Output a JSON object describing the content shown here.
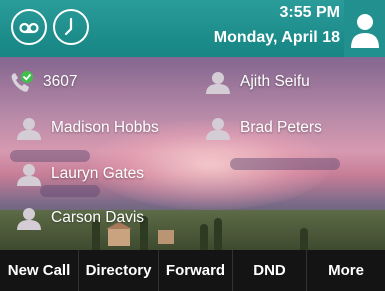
{
  "status_bar": {
    "time": "3:55 PM",
    "date": "Monday, April 18"
  },
  "icons": {
    "voicemail": "voicemail-icon",
    "clock": "clock-icon",
    "user": "user-avatar-icon",
    "phone": "phone-registered-icon",
    "contact": "person-icon"
  },
  "contacts": [
    {
      "name": "3607",
      "icon": "phone-registered-icon"
    },
    {
      "name": "Ajith Seifu",
      "icon": "person-icon"
    },
    {
      "name": "Madison Hobbs",
      "icon": "person-icon"
    },
    {
      "name": "Brad Peters",
      "icon": "person-icon"
    },
    {
      "name": "Lauryn Gates",
      "icon": "person-icon"
    },
    {
      "name": "Carson Davis",
      "icon": "person-icon"
    }
  ],
  "softkeys": [
    "New Call",
    "Directory",
    "Forward",
    "DND",
    "More"
  ],
  "colors": {
    "header": "#1a8b89",
    "softkey_bar": "#141414",
    "registered_check": "#3fbf4a"
  }
}
